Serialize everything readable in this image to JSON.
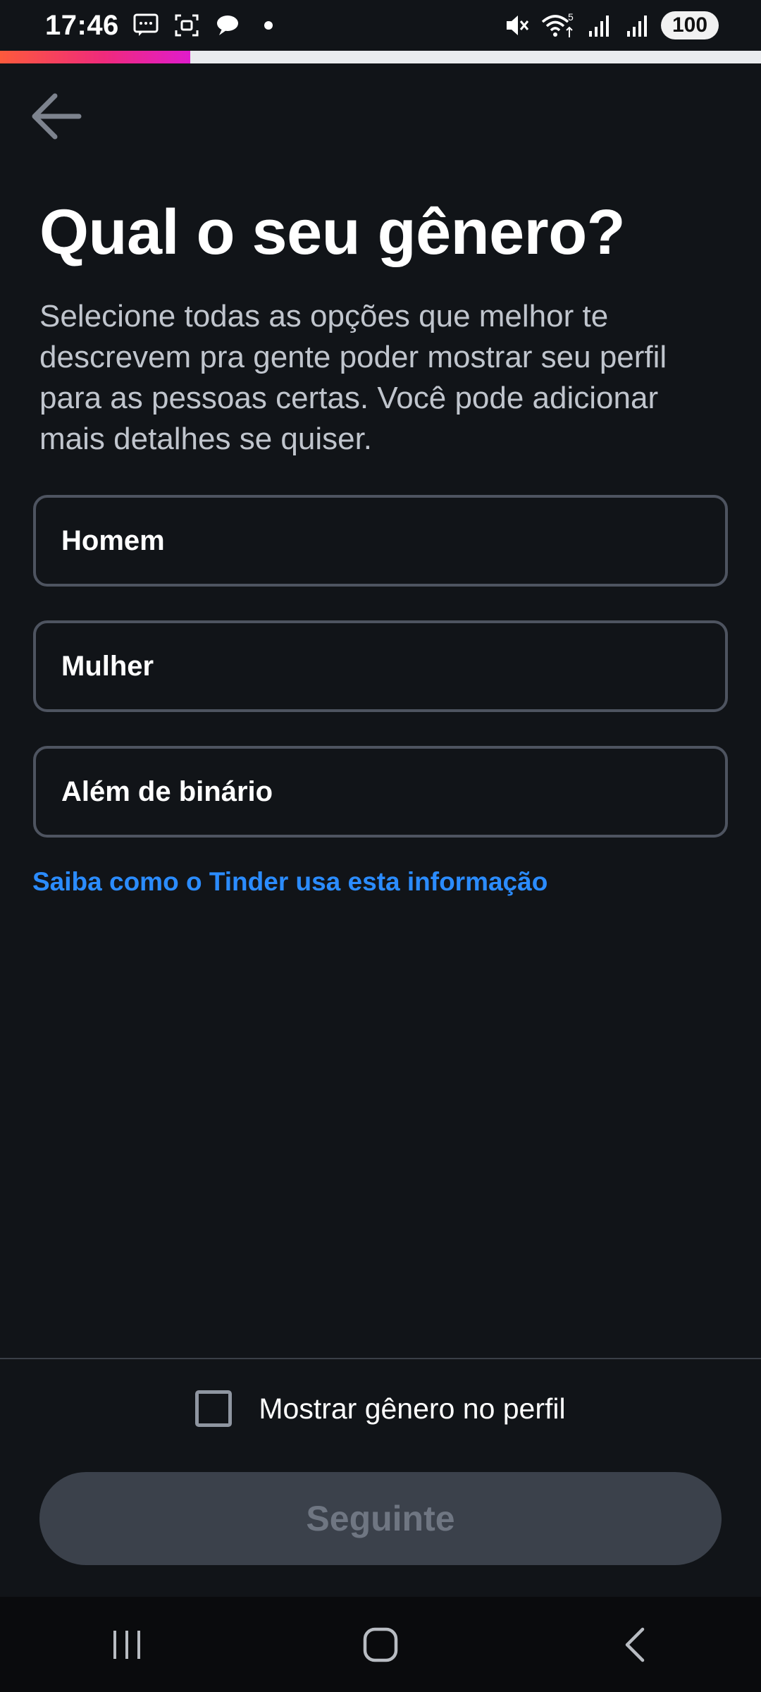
{
  "status_bar": {
    "time": "17:46",
    "battery": "100",
    "network_badge": "5"
  },
  "progress": {
    "fraction": 0.25
  },
  "title": "Qual o seu gênero?",
  "description": "Selecione todas as opções que melhor te descrevem pra gente poder mostrar seu perfil para as pessoas certas. Você pode adicionar mais detalhes se quiser.",
  "options": [
    {
      "label": "Homem"
    },
    {
      "label": "Mulher"
    },
    {
      "label": "Além de binário"
    }
  ],
  "learn_more_link": "Saiba como o Tinder usa esta informação",
  "show_gender_checkbox": {
    "label": "Mostrar gênero no perfil",
    "checked": false
  },
  "next_button": {
    "label": "Seguinte",
    "enabled": false
  },
  "colors": {
    "background": "#111418",
    "link": "#2b8cff",
    "progress_start": "#fd5a3c",
    "progress_end": "#e01ccc",
    "button_disabled": "#3b414b"
  }
}
